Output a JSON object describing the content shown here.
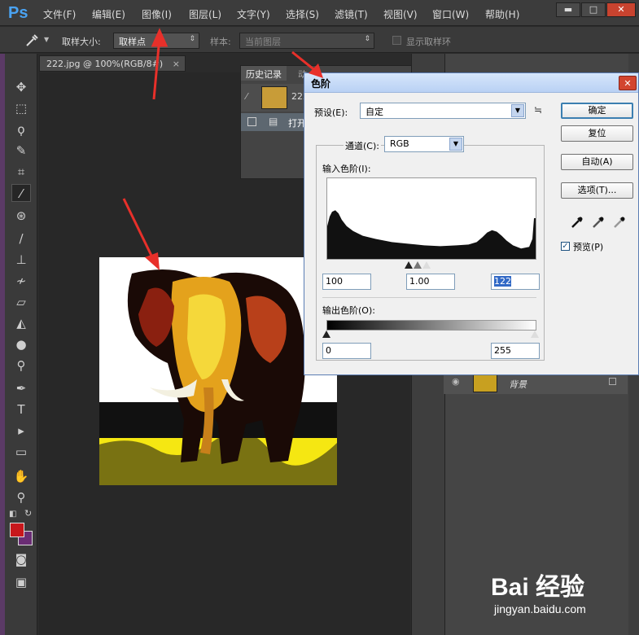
{
  "app": {
    "logo": "Ps",
    "menu": [
      "文件(F)",
      "编辑(E)",
      "图像(I)",
      "图层(L)",
      "文字(Y)",
      "选择(S)",
      "滤镜(T)",
      "视图(V)",
      "窗口(W)",
      "帮助(H)"
    ],
    "window_buttons": {
      "minimize": "▬",
      "maximize": "□",
      "close": "✕"
    }
  },
  "options_bar": {
    "sample_size_label": "取样大小:",
    "sample_size_value": "取样点",
    "sample_label": "样本:",
    "sample_value": "当前图层",
    "show_ring_label": "显示取样环"
  },
  "document": {
    "tab_title": "222.jpg @ 100%(RGB/8#)",
    "close": "×"
  },
  "history_panel": {
    "tab_label": "历史记录",
    "tab2_label": "动",
    "snapshot_name": "222",
    "step_label": "打开"
  },
  "layers": {
    "layer_name": "背景"
  },
  "levels_dialog": {
    "title": "色阶",
    "close": "✕",
    "preset_label": "预设(E):",
    "preset_value": "自定",
    "channel_label": "通道(C):",
    "channel_value": "RGB",
    "input_levels_label": "输入色阶(I):",
    "input_black": "100",
    "input_gamma": "1.00",
    "input_white": "122",
    "output_levels_label": "输出色阶(O):",
    "output_black": "0",
    "output_white": "255",
    "ok": "确定",
    "reset": "复位",
    "auto": "自动(A)",
    "options": "选项(T)...",
    "preview_label": "预览(P)",
    "preview_checked": true
  },
  "watermark": {
    "logo": "Bai 经验",
    "url": "jingyan.baidu.com"
  },
  "colors": {
    "foreground": "#c8171c",
    "background": "#6a2d74",
    "annotation_arrow": "#e8302a"
  }
}
